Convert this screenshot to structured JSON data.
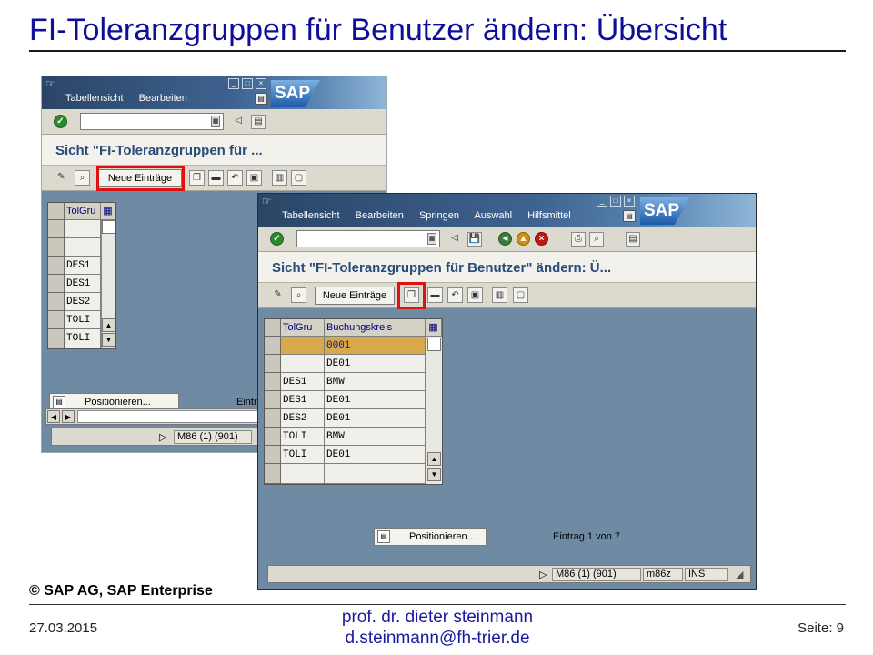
{
  "slide": {
    "title": "FI-Toleranzgruppen für Benutzer ändern: Übersicht",
    "copyright": "© SAP AG, SAP Enterprise",
    "date": "27.03.2015",
    "author_line1": "prof. dr. dieter steinmann",
    "author_line2": "d.steinmann@fh-trier.de",
    "page": "Seite: 9"
  },
  "back_window": {
    "menu": [
      "Tabellensicht",
      "Bearbeiten"
    ],
    "logo": "SAP",
    "view_title": "Sicht \"FI-Toleranzgruppen für ...",
    "new_entries_button": "Neue Einträge",
    "table_header": "TolGru",
    "rows": [
      "",
      "",
      "DES1",
      "DES1",
      "DES2",
      "TOLI",
      "TOLI"
    ],
    "position_button": "Positionieren...",
    "entry_text_partial": "Eintr",
    "status_session": "M86 (1) (901)"
  },
  "front_window": {
    "menu": [
      "Tabellensicht",
      "Bearbeiten",
      "Springen",
      "Auswahl",
      "Hilfsmittel"
    ],
    "logo": "SAP",
    "view_title": "Sicht \"FI-Toleranzgruppen für Benutzer\" ändern: Ü...",
    "new_entries_button": "Neue Einträge",
    "columns": [
      "TolGru",
      "Buchungskreis"
    ],
    "rows": [
      {
        "tolgru": "",
        "bukrs": "0001"
      },
      {
        "tolgru": "",
        "bukrs": "DE01"
      },
      {
        "tolgru": "DES1",
        "bukrs": "BMW"
      },
      {
        "tolgru": "DES1",
        "bukrs": "DE01"
      },
      {
        "tolgru": "DES2",
        "bukrs": "DE01"
      },
      {
        "tolgru": "TOLI",
        "bukrs": "BMW"
      },
      {
        "tolgru": "TOLI",
        "bukrs": "DE01"
      },
      {
        "tolgru": "",
        "bukrs": ""
      }
    ],
    "position_button": "Positionieren...",
    "entry_text": "Eintrag 1 von 7",
    "status_session": "M86 (1) (901)",
    "status_host": "m86z",
    "status_mode": "INS"
  },
  "colors": {
    "title_blue": "#0e0e9a",
    "highlight_red": "#e01010",
    "sap_background": "#6f8aa3",
    "selected_row": "#d7a94a"
  }
}
